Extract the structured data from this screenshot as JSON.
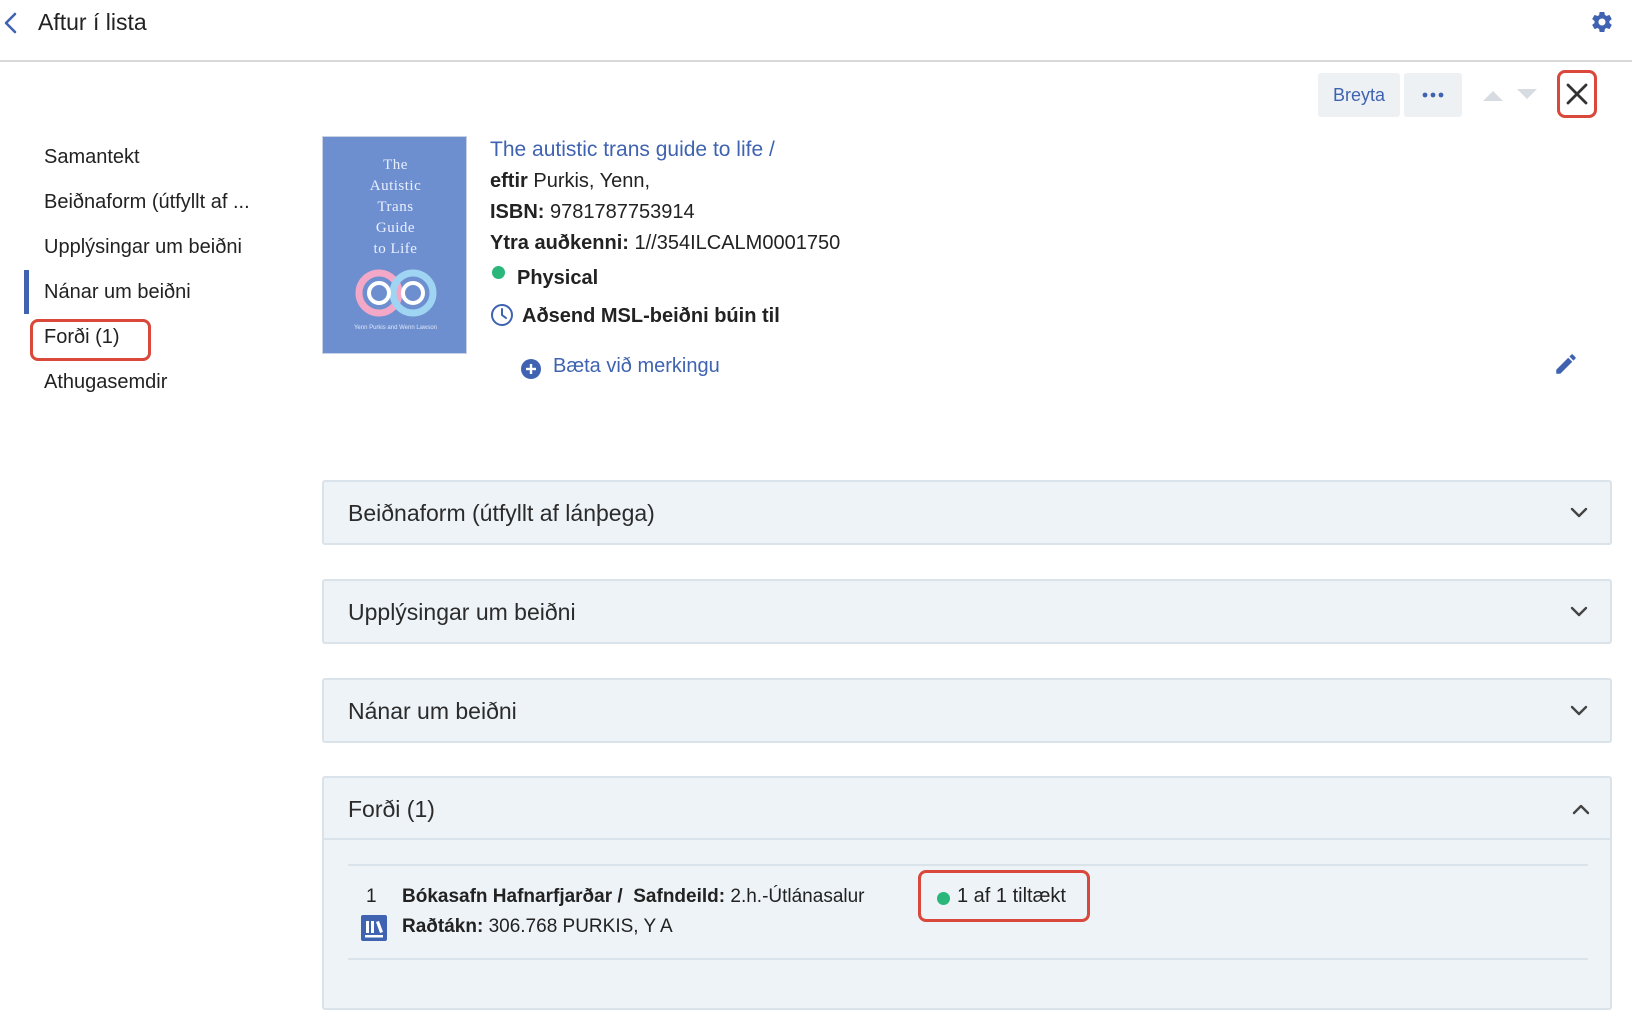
{
  "header": {
    "back_label": "Aftur í lista"
  },
  "toolbar": {
    "edit_label": "Breyta",
    "more_label": "•••"
  },
  "nav": {
    "items": [
      {
        "label": "Samantekt"
      },
      {
        "label": "Beiðnaform (útfyllt af ..."
      },
      {
        "label": "Upplýsingar um beiðni"
      },
      {
        "label": "Nánar um beiðni",
        "active": true
      },
      {
        "label": "Forði (1)",
        "highlighted": true
      },
      {
        "label": "Athugasemdir"
      }
    ]
  },
  "record": {
    "cover": {
      "title_lines": [
        "The",
        "Autistic",
        "Trans",
        "Guide",
        "to Life"
      ],
      "authors": "Yenn Purkis and Wenn Lawson"
    },
    "title": "The autistic trans guide to life /",
    "author_label": "eftir",
    "author_value": "Purkis, Yenn,",
    "isbn_label": "ISBN:",
    "isbn_value": "9781787753914",
    "external_id_label": "Ytra auðkenni:",
    "external_id_value": "1//354ILCALM0001750",
    "format": "Physical",
    "status": "Aðsend MSL-beiðni búin til",
    "add_tag_label": "Bæta við merkingu"
  },
  "sections": [
    {
      "label": "Beiðnaform (útfyllt af lánþega)",
      "expanded": false
    },
    {
      "label": "Upplýsingar um beiðni",
      "expanded": false
    },
    {
      "label": "Nánar um beiðni",
      "expanded": false
    },
    {
      "label": "Forði (1)",
      "expanded": true
    }
  ],
  "holdings": {
    "index": "1",
    "library": "Bókasafn Hafnarfjarðar /",
    "location_label": "Safndeild:",
    "location_value": "2.h.-Útlánasalur",
    "call_number_label": "Raðtákn:",
    "call_number_value": "306.768 PURKIS, Y A",
    "availability": "1 af 1 tiltækt"
  },
  "colors": {
    "accent": "#3f63b0",
    "highlight_border": "#d9483b",
    "available": "#2bb67a",
    "section_bg": "#eef3f7"
  }
}
